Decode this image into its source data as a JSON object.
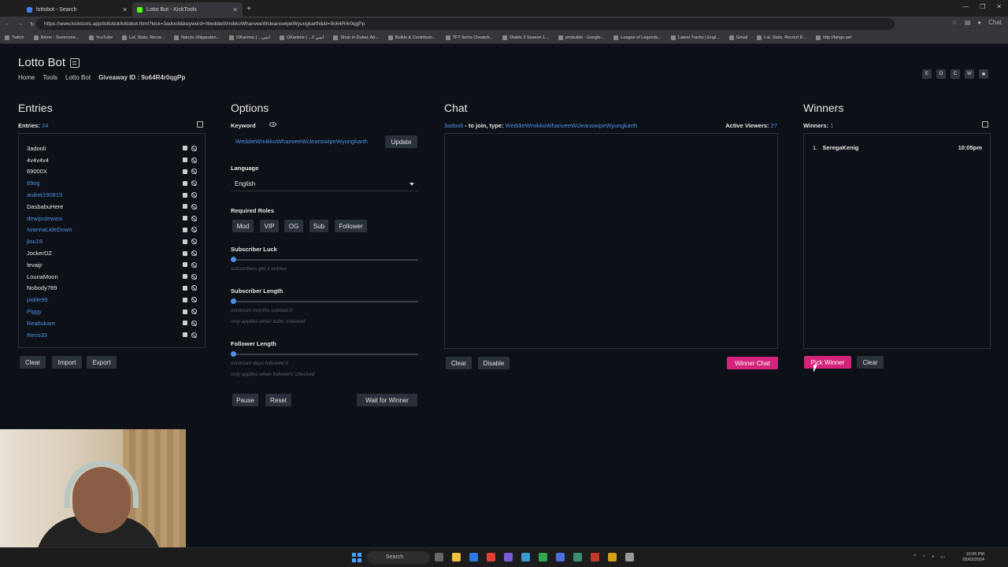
{
  "browser": {
    "tabs": [
      {
        "label": "lottobot - Search",
        "active": false
      },
      {
        "label": "Lotto Bot - KickTools",
        "active": true
      }
    ],
    "url": "https://www.kicktools.app/lottobot/lottobot.html?kick=3adooli&keyword=WeddieWmikkoWhanveeWcleanswipeWyungkarth&id=9o64R4r0qgPp",
    "bookmarks": [
      "Twitch",
      "Ikiimo - Summone...",
      "YouTube",
      "LoL Stats, Recor...",
      "Naruto Shippuden...",
      "OKanime | ...انمي",
      "OKanime | ...2 انمي",
      "Shop in Dubai, Ab...",
      "Builds & Contributo...",
      "TFT Items Cheatsh...",
      "Diablo 3 Season 1...",
      "probuilds - Google...",
      "League of Legends...",
      "Latest Tracks | Engl...",
      "Gmail",
      "LoL Stats, Record R...",
      "http://binge.ae/"
    ],
    "profile_label": "Chat"
  },
  "header": {
    "title": "Lotto Bot",
    "breadcrumb": [
      "Home",
      "Tools",
      "Lotto Bot"
    ],
    "giveaway_label": "Giveaway ID :",
    "giveaway_id": "9o64R4r0qgPp",
    "top_buttons": [
      "E",
      "O",
      "C",
      "W",
      "✱"
    ]
  },
  "entries": {
    "title": "Entries",
    "count_label": "Entries:",
    "count": "24",
    "items": [
      {
        "name": "3adooli",
        "blue": false
      },
      {
        "name": "4v4v4v4",
        "blue": false
      },
      {
        "name": "69000X",
        "blue": false
      },
      {
        "name": "69og",
        "blue": true
      },
      {
        "name": "aniket190819",
        "blue": true
      },
      {
        "name": "DasbabuHere",
        "blue": false
      },
      {
        "name": "dewiputewasi",
        "blue": true
      },
      {
        "name": "IwannaLideDown",
        "blue": true
      },
      {
        "name": "jlou16",
        "blue": true
      },
      {
        "name": "JockerDZ",
        "blue": false
      },
      {
        "name": "levaijr",
        "blue": false
      },
      {
        "name": "LounaMoon",
        "blue": false
      },
      {
        "name": "Nobody789",
        "blue": false
      },
      {
        "name": "pidde99",
        "blue": true
      },
      {
        "name": "Piggy",
        "blue": true
      },
      {
        "name": "Realtukam",
        "blue": true
      },
      {
        "name": "Reco33",
        "blue": true
      }
    ],
    "buttons": {
      "clear": "Clear",
      "import": "Import",
      "export": "Export"
    }
  },
  "options": {
    "title": "Options",
    "keyword_label": "Keyword",
    "keyword_value": "WeddieWmikkoWhanveeWcleanswipeWyungkarth",
    "update": "Update",
    "language_label": "Language",
    "language_value": "English",
    "roles_label": "Required Roles",
    "roles": [
      "Mod",
      "VIP",
      "OG",
      "Sub",
      "Follower"
    ],
    "sub_luck_label": "Subscriber Luck",
    "sub_luck_hint": "subscribers get 1 entries",
    "sub_luck_value": 0,
    "sub_length_label": "Subscriber Length",
    "sub_length_hint1": "minimum months subbed 0",
    "sub_length_hint2": "only applies when subs' checked",
    "sub_length_value": 0,
    "follower_label": "Follower Length",
    "follower_hint1": "minimum days followed 0",
    "follower_hint2": "only applies when followers' checked",
    "follower_value": 0,
    "pause": "Pause",
    "reset": "Reset",
    "wait": "Wait for Winner"
  },
  "chat": {
    "title": "Chat",
    "channel": "3adooli",
    "join_text": " - to join, type: ",
    "join_keyword": "WeddieWmikkoWhanveeWcleanswipeWyungkarth",
    "viewers_label": "Active Viewers:",
    "viewers": "27",
    "clear": "Clear",
    "disable": "Disable",
    "winner_chat": "Winner Chat"
  },
  "winners": {
    "title": "Winners",
    "count_label": "Winners:",
    "count": "1",
    "items": [
      {
        "rank": "1.",
        "name": "SeregaKenig",
        "time": "10:05pm"
      }
    ],
    "pick": "Pick Winner",
    "clear": "Clear"
  },
  "taskbar": {
    "search": "Search",
    "time": "10:06 PM",
    "date": "05/02/2024"
  },
  "colors": {
    "accent": "#4f8fe6",
    "pink": "#d4237a",
    "bg": "#0d1117"
  }
}
